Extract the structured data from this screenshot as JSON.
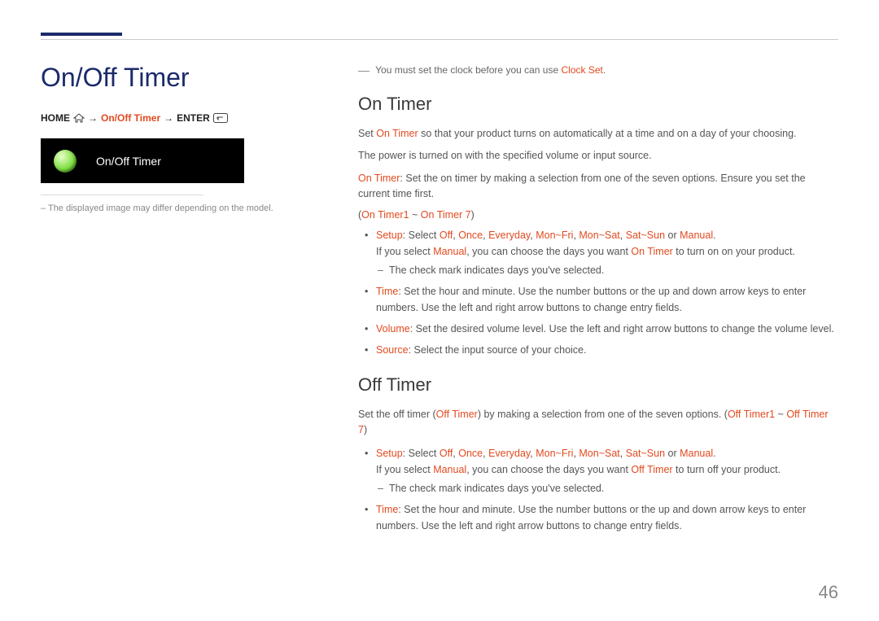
{
  "page": {
    "title": "On/Off Timer",
    "number": "46"
  },
  "breadcrumb": {
    "home": "HOME",
    "path": "On/Off Timer",
    "enter": "ENTER"
  },
  "tile": {
    "label": "On/Off Timer"
  },
  "disclaimer": "–   The displayed image may differ depending on the model.",
  "info": {
    "pre": "You must set the clock before you can use ",
    "hl": "Clock Set",
    "post": "."
  },
  "on_timer": {
    "heading": "On Timer",
    "p1_pre": "Set ",
    "p1_hl": "On Timer",
    "p1_post": " so that your product turns on automatically at a time and on a day of your choosing.",
    "p2": "The power is turned on with the specified volume or input source.",
    "p3_hl": "On Timer",
    "p3_post": ": Set the on timer by making a selection from one of the seven options. Ensure you set the current time first.",
    "range_open": "(",
    "range_a": "On Timer1",
    "range_mid": " ~ ",
    "range_b": "On Timer 7",
    "range_close": ")",
    "setup": {
      "label": "Setup",
      "select": ": Select ",
      "options": [
        "Off",
        "Once",
        "Everyday",
        "Mon~Fri",
        "Mon~Sat",
        "Sat~Sun",
        "Manual"
      ],
      "or": " or ",
      "sep": ", ",
      "period": ".",
      "manual_pre": "If you select ",
      "manual_hl": "Manual",
      "manual_mid": ", you can choose the days you want ",
      "manual_target": "On Timer",
      "manual_post": " to turn on on your product.",
      "check": "The check mark indicates days you've selected."
    },
    "time": {
      "label": "Time",
      "text": ": Set the hour and minute. Use the number buttons or the up and down arrow keys to enter numbers. Use the left and right arrow buttons to change entry fields."
    },
    "volume": {
      "label": "Volume",
      "text": ": Set the desired volume level. Use the left and right arrow buttons to change the volume level."
    },
    "source": {
      "label": "Source",
      "text": ": Select the input source of your choice."
    }
  },
  "off_timer": {
    "heading": "Off Timer",
    "p1_pre": "Set the off timer (",
    "p1_hl": "Off Timer",
    "p1_mid": ") by making a selection from one of the seven options. (",
    "p1_range_a": "Off Timer1",
    "p1_range_mid": " ~ ",
    "p1_range_b": "Off Timer 7",
    "p1_close": ")",
    "setup": {
      "label": "Setup",
      "select": ": Select ",
      "options": [
        "Off",
        "Once",
        "Everyday",
        "Mon~Fri",
        "Mon~Sat",
        "Sat~Sun",
        "Manual"
      ],
      "or": " or ",
      "sep": ", ",
      "period": ".",
      "manual_pre": "If you select ",
      "manual_hl": "Manual",
      "manual_mid": ", you can choose the days you want ",
      "manual_target": "Off Timer",
      "manual_post": " to turn off your product.",
      "check": "The check mark indicates days you've selected."
    },
    "time": {
      "label": "Time",
      "text": ": Set the hour and minute. Use the number buttons or the up and down arrow keys to enter numbers. Use the left and right arrow buttons to change entry fields."
    }
  }
}
